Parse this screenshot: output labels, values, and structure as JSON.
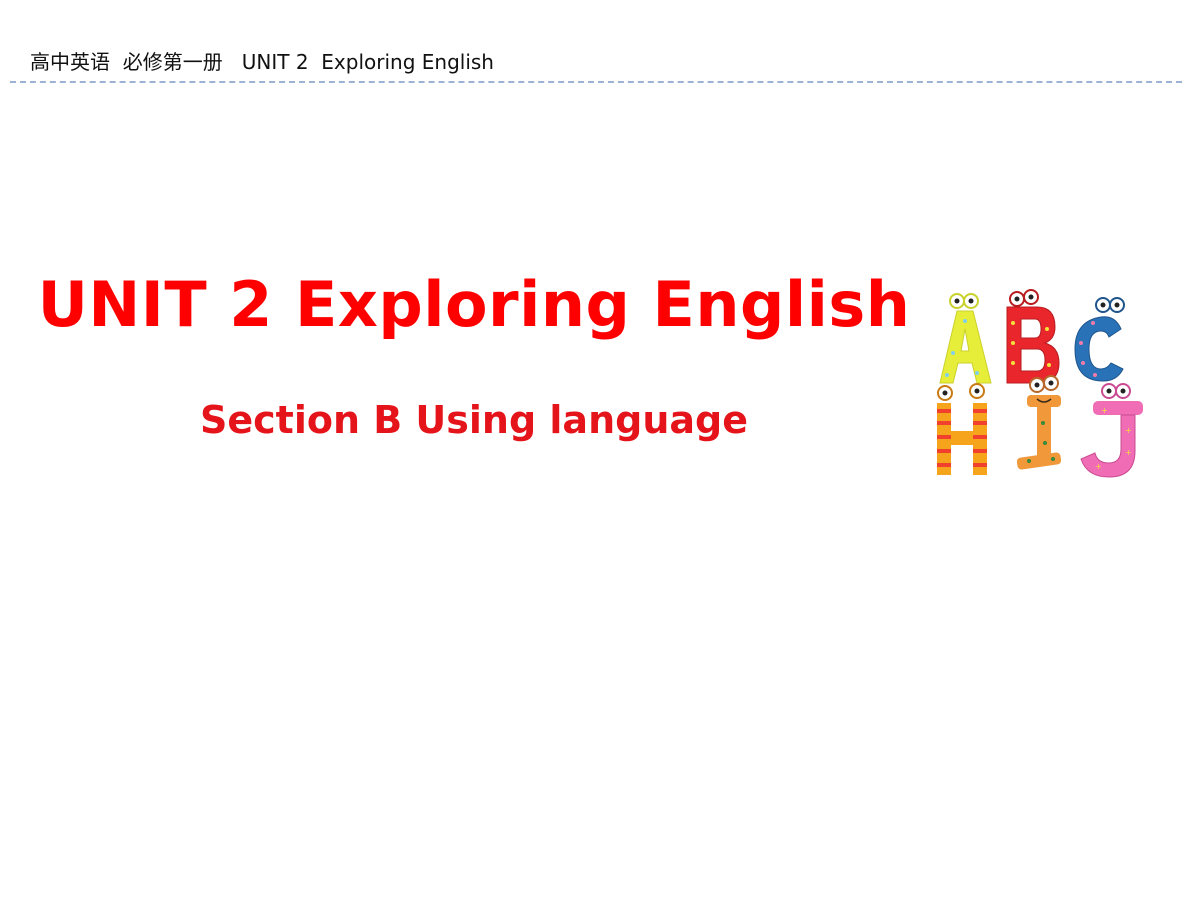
{
  "header": {
    "text": "高中英语  必修第一册   UNIT 2  Exploring English"
  },
  "slide": {
    "title": "UNIT 2 Exploring English",
    "subtitle": "Section B Using language"
  },
  "illustration": {
    "icon": "alphabet-letters-illustration",
    "letters": [
      "A",
      "B",
      "C",
      "H",
      "I",
      "J"
    ],
    "colors": {
      "A": "#e7ee3a",
      "B": "#e8262b",
      "C": "#2a72b8",
      "H": "#f7a41d",
      "I": "#f0983a",
      "J": "#f06cb5",
      "stripe": "#f2402f"
    }
  },
  "colors": {
    "title": "#ff0000",
    "rule": "#9db3d6"
  }
}
